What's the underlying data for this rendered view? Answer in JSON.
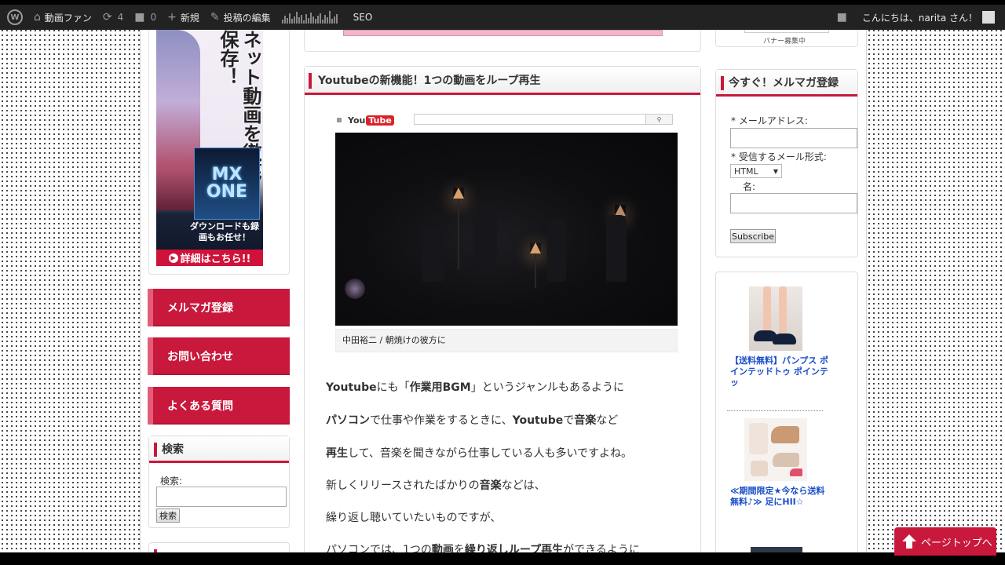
{
  "admin_bar": {
    "wp_logo": "W",
    "site_name": "動画ファン",
    "updates_count": "4",
    "comments_count": "0",
    "new_label": "新規",
    "edit_label": "投稿の編集",
    "seo_label": "SEO",
    "greeting": "こんにちは、narita さん！",
    "icons": [
      "wordpress-logo",
      "dashboard-icon",
      "updates-icon",
      "comments-icon",
      "plus-icon",
      "pencil-icon",
      "stats-bars",
      "notification-icon",
      "avatar"
    ]
  },
  "left_sidebar": {
    "ad": {
      "headline": "ネット動画を徹底保存！",
      "logo_line1": "MX",
      "logo_line2": "ONE",
      "subtext": "ダウンロードも録画もお任せ！",
      "cta": "詳細はこちら!!"
    },
    "menu": [
      {
        "label": "メルマガ登録"
      },
      {
        "label": "お問い合わせ"
      },
      {
        "label": "よくある質問"
      }
    ],
    "search_widget": {
      "title": "検索",
      "label": "検索:",
      "button": "検索"
    }
  },
  "post": {
    "title": "Youtubeの新機能！1つの動画をループ再生",
    "embed": {
      "logo_you": "You",
      "logo_tube": "Tube",
      "search_icon": "magnifier",
      "caption": "中田裕二 / 朝焼けの彼方に"
    },
    "paragraphs": [
      {
        "segments": [
          {
            "t": "Youtube",
            "b": true
          },
          {
            "t": "にも「",
            "b": false
          },
          {
            "t": "作業用BGM",
            "b": true
          },
          {
            "t": "」というジャンルもあるように",
            "b": false
          }
        ]
      },
      {
        "segments": [
          {
            "t": "パソコン",
            "b": true
          },
          {
            "t": "で仕事や作業をするときに、",
            "b": false
          },
          {
            "t": "Youtube",
            "b": true
          },
          {
            "t": "で",
            "b": false
          },
          {
            "t": "音楽",
            "b": true
          },
          {
            "t": "など",
            "b": false
          }
        ]
      },
      {
        "segments": [
          {
            "t": "再生",
            "b": true
          },
          {
            "t": "して、音楽を聞きながら仕事している人も多いですよね。",
            "b": false
          }
        ]
      },
      {
        "segments": [
          {
            "t": "新しくリリースされたばかりの",
            "b": false
          },
          {
            "t": "音楽",
            "b": true
          },
          {
            "t": "などは、",
            "b": false
          }
        ]
      },
      {
        "segments": [
          {
            "t": "繰り返し聴いていたいものですが、",
            "b": false
          }
        ]
      },
      {
        "segments": [
          {
            "t": "パソコンでは、1つの",
            "b": false
          },
          {
            "t": "動画",
            "b": true
          },
          {
            "t": "を",
            "b": false
          },
          {
            "t": "繰り返し",
            "b": true
          },
          {
            "t": "ループ再生",
            "b": true
          },
          {
            "t": "ができるように",
            "b": false
          }
        ]
      }
    ]
  },
  "right_sidebar": {
    "top_caption": "バナー募集中",
    "newsletter": {
      "title": "今すぐ！メルマガ登録",
      "email_label": "* メールアドレス:",
      "format_label": "* 受信するメール形式:",
      "format_value": "HTML",
      "name_label": "名:",
      "submit": "Subscribe"
    },
    "ads": [
      {
        "caption": "【送料無料】パンプス ポインテッドトゥ ポインテッ"
      },
      {
        "caption": "≪期間限定★今なら送料無料♪≫ 足にHII☆"
      }
    ]
  },
  "back_to_top": "ページトップへ"
}
